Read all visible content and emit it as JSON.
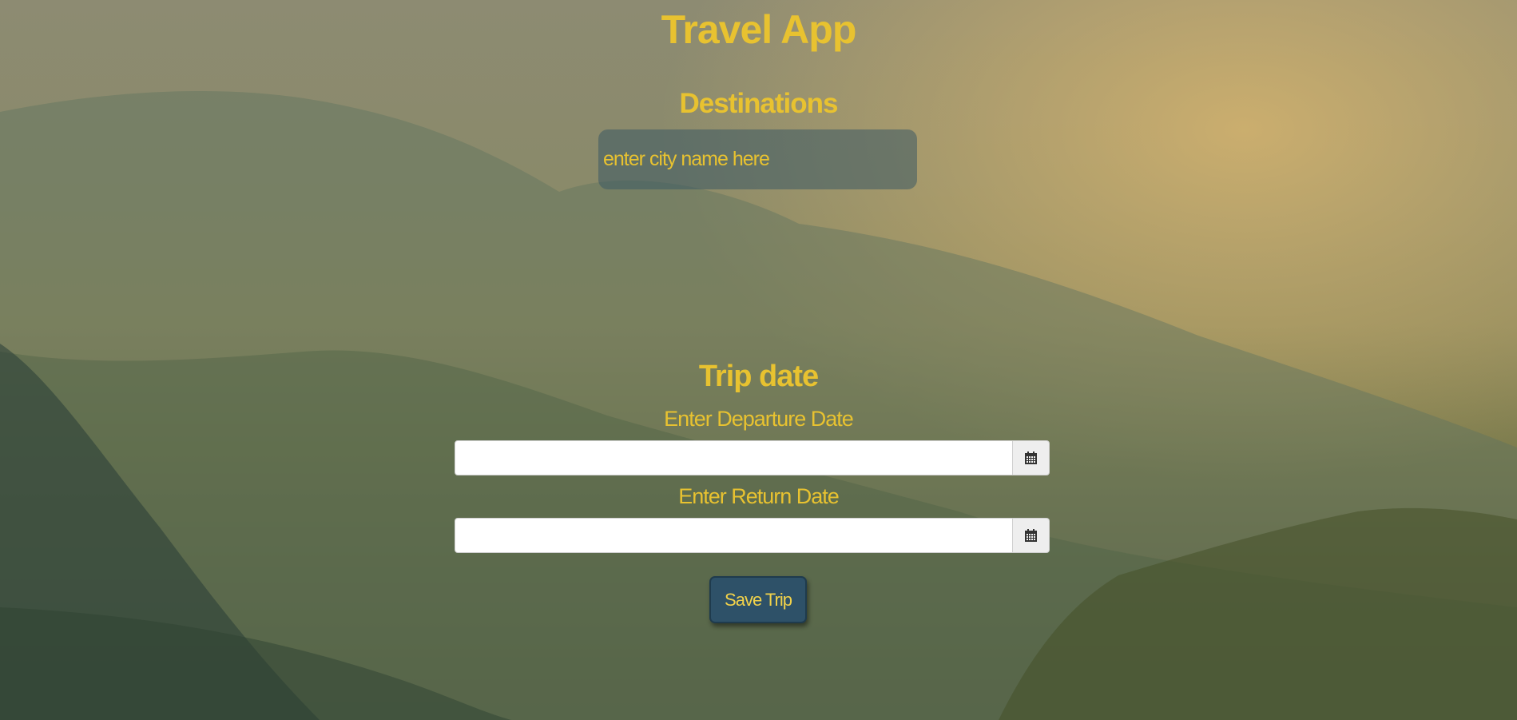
{
  "app": {
    "title": "Travel App"
  },
  "destinations": {
    "heading": "Destinations",
    "city_placeholder": "enter city name here"
  },
  "trip_date": {
    "heading": "Trip date",
    "departure_label": "Enter Departure Date",
    "return_label": "Enter Return Date",
    "departure_value": "",
    "return_value": "",
    "calendar_icon": "calendar-icon"
  },
  "actions": {
    "save_label": "Save Trip"
  },
  "colors": {
    "accent_text": "#e8c230",
    "button_bg": "#2e5168",
    "input_bg": "rgba(60,90,100,0.55)"
  }
}
